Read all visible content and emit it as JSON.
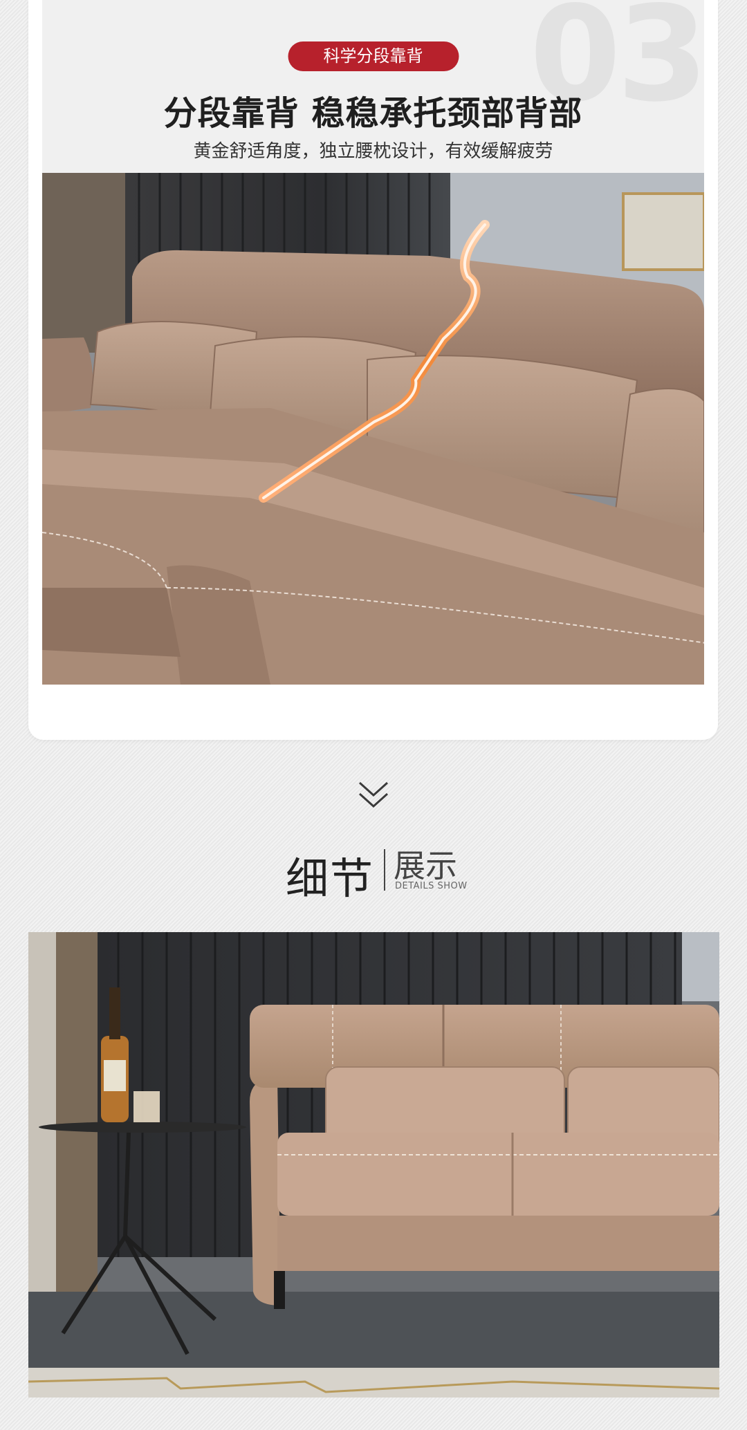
{
  "section3": {
    "number": "03",
    "badge": "科学分段靠背",
    "headline": "分段靠背 稳稳承托颈部背部",
    "subline": "黄金舒适角度，独立腰枕设计，有效缓解疲劳"
  },
  "details": {
    "title_main": "细节",
    "title_sub": "展示",
    "title_en": "DETAILS SHOW"
  },
  "colors": {
    "accent": "#b7212c",
    "leather": "#a88a76",
    "highlight_line": "#f07a2a"
  },
  "icons": {
    "chevron": "double-chevron-down-icon"
  }
}
